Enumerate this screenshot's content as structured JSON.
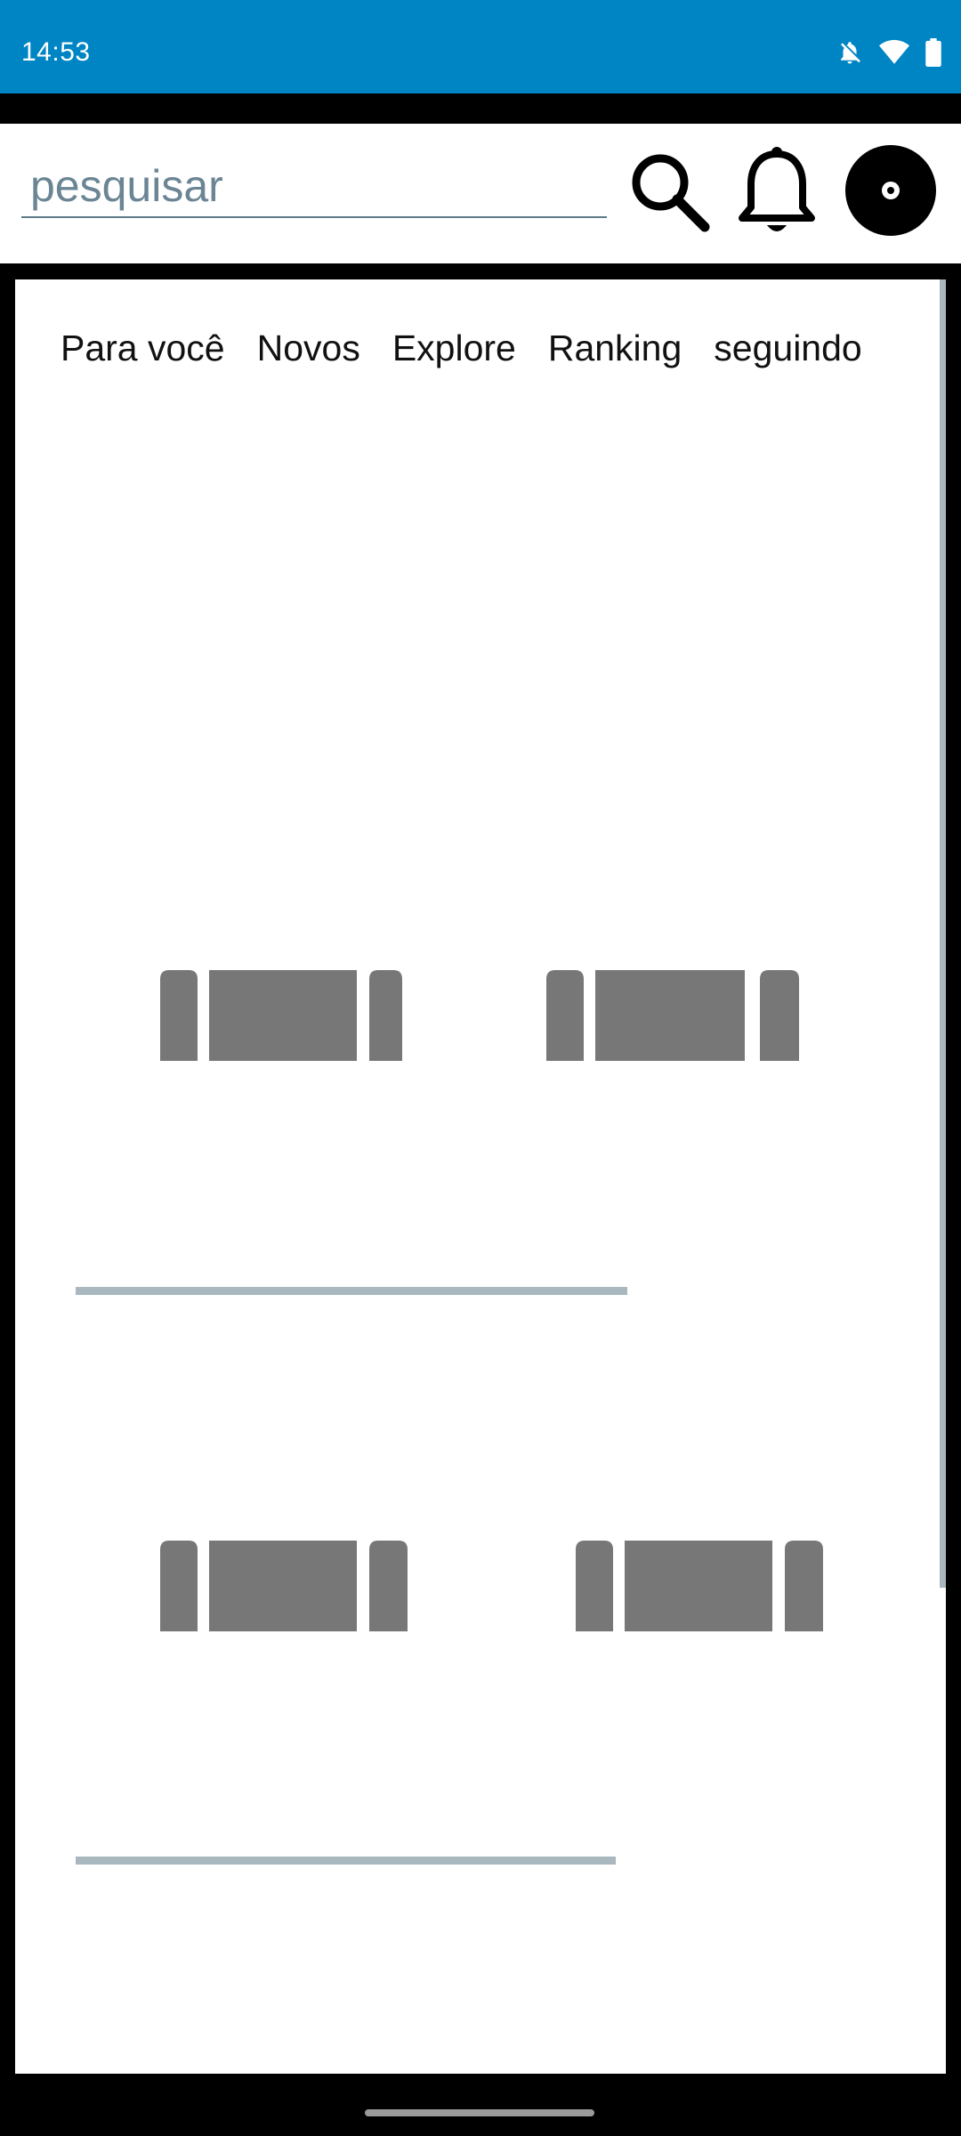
{
  "status_bar": {
    "time": "14:53",
    "background_color": "#0085c4",
    "icons": [
      "notifications-off-icon",
      "wifi-icon",
      "battery-icon"
    ]
  },
  "header": {
    "search": {
      "value": "",
      "placeholder": "pesquisar"
    },
    "icons": [
      "search-icon",
      "bell-icon",
      "avatar-icon"
    ]
  },
  "tabs": [
    "Para você",
    "Novos",
    "Explore",
    "Ranking",
    "seguindo"
  ],
  "feed": {
    "placeholder_color": "#777777",
    "divider_color": "#a9b8bf"
  }
}
